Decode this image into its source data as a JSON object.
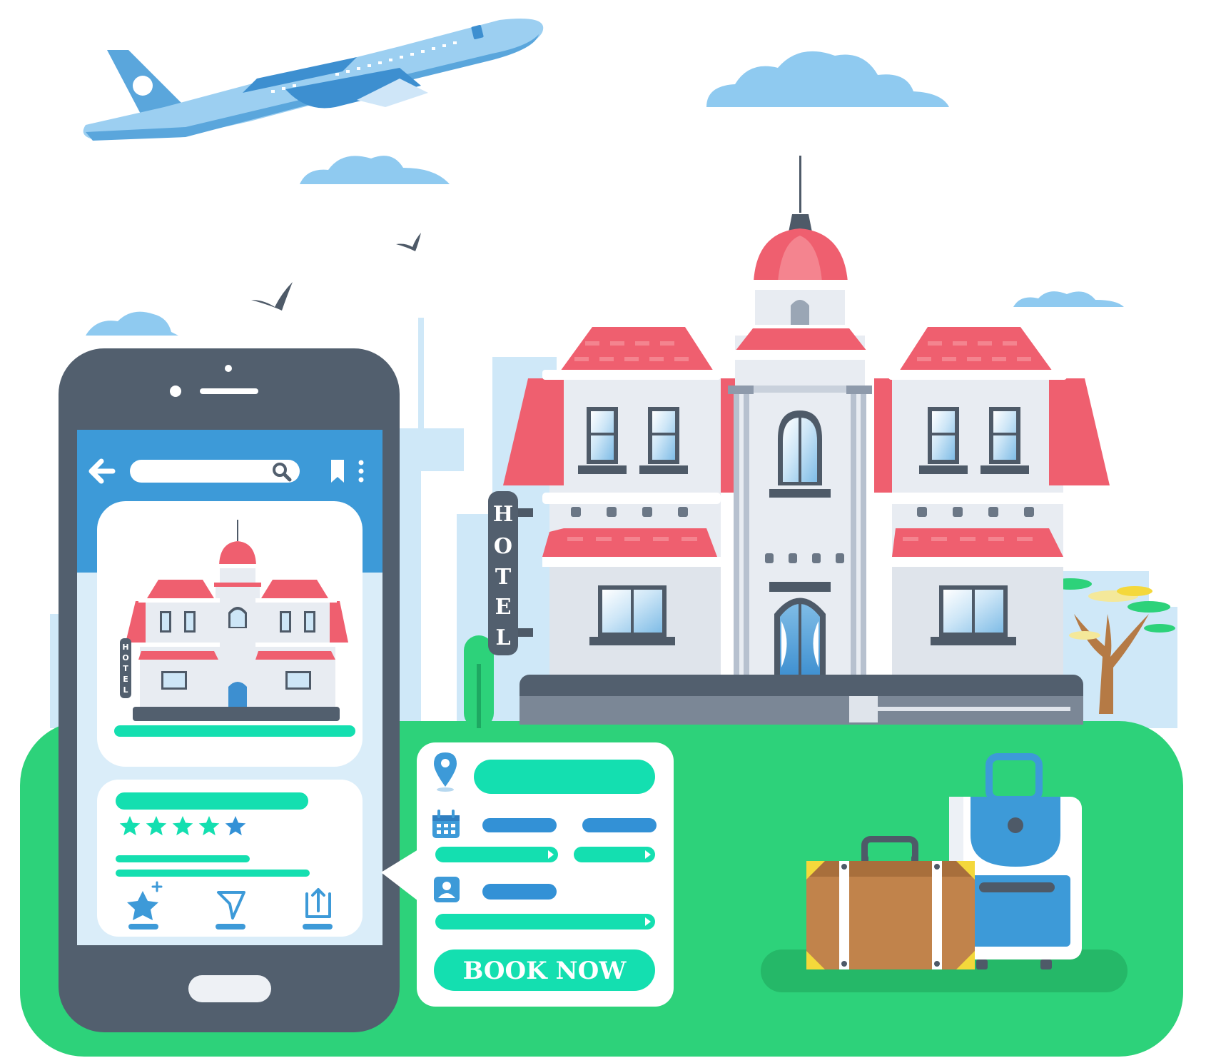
{
  "colors": {
    "ground": "#2dd27a",
    "ground_shadow": "#25b868",
    "sky_blue": "#8fcaf0",
    "skyline": "#cfe8f8",
    "phone_body": "#525f6e",
    "phone_screen": "#daedf9",
    "app_bar": "#3d9ad8",
    "teal": "#14dfb0",
    "blue_bar": "#3391d6",
    "roof_red": "#ef5f6f",
    "wall": "#e8ecf2",
    "suitcase_brown": "#c1834b",
    "suitcase_yellow": "#f4d83b",
    "luggage_blue": "#3d9ad8"
  },
  "icons": {
    "back": "arrow-left-icon",
    "search": "search-icon",
    "bookmark": "bookmark-icon",
    "more": "more-vertical-icon",
    "favorite": "star-plus-icon",
    "send": "send-icon",
    "share": "share-icon",
    "location": "location-pin-icon",
    "calendar": "calendar-icon",
    "guest": "user-badge-icon"
  },
  "hotel_sign": {
    "letters": [
      "H",
      "O",
      "T",
      "E",
      "L"
    ]
  },
  "phone_sign": {
    "letters": [
      "H",
      "O",
      "T",
      "E",
      "L"
    ]
  },
  "listing": {
    "rating_stars": 5,
    "rating_max": 5
  },
  "booking": {
    "button_label": "BOOK NOW"
  }
}
